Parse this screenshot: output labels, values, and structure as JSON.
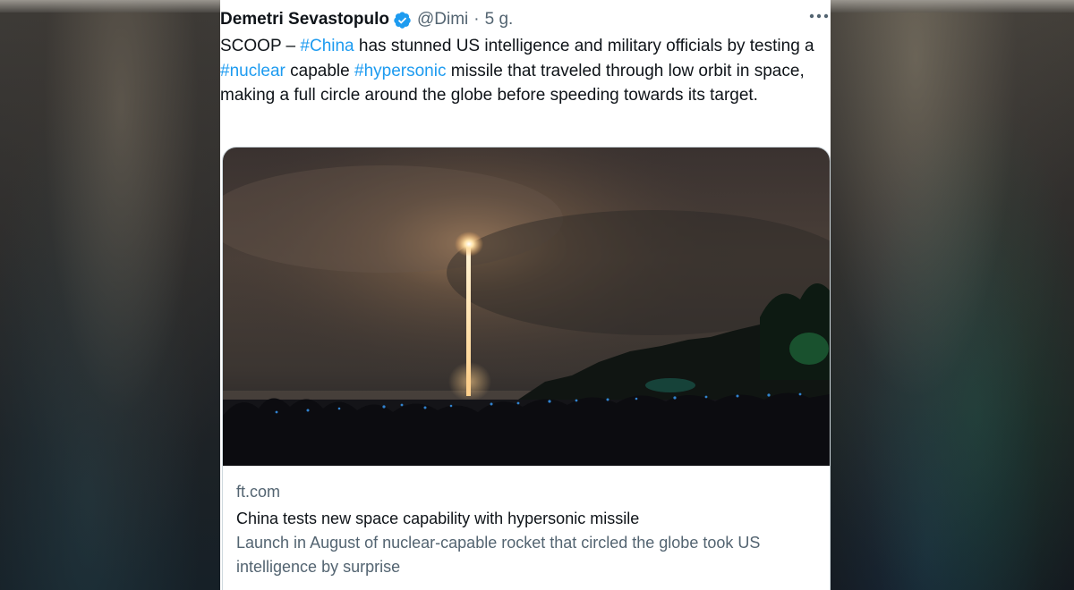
{
  "tweet": {
    "author_name": "Demetri Sevastopulo",
    "handle": "@Dimi",
    "separator": "·",
    "time": "5 g.",
    "text_parts": {
      "p1": "SCOOP – ",
      "h1": "#China",
      "p2": " has stunned US intelligence and military officials by testing a ",
      "h2": "#nuclear",
      "p3": " capable ",
      "h3": "#hypersonic",
      "p4": " missile that traveled through low orbit in space, making a full circle around the globe before speeding towards its target."
    }
  },
  "card": {
    "domain": "ft.com",
    "title": "China tests new space capability with hypersonic missile",
    "description": "Launch in August of nuclear-capable rocket that circled the globe took US intelligence by surprise"
  },
  "icons": {
    "verified": "verified-badge-icon",
    "more": "more-options-icon"
  },
  "colors": {
    "accent": "#1d9bf0",
    "text": "#0f1419",
    "muted": "#536471"
  }
}
